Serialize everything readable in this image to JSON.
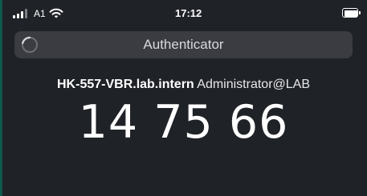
{
  "status_bar": {
    "carrier": "A1",
    "time": "17:12",
    "icons": [
      "signal-icon",
      "wifi-icon",
      "battery-icon"
    ]
  },
  "header": {
    "title": "Authenticator",
    "icon": "spinner-icon"
  },
  "account": {
    "server": "HK-557-VBR.lab.intern",
    "user": "Administrator@LAB"
  },
  "otp": {
    "code": "14 75 66"
  },
  "colors": {
    "background": "#1f2227",
    "header_bg": "#3a3c42",
    "text": "#ffffff",
    "accent_edge": "#0f5a4a"
  }
}
